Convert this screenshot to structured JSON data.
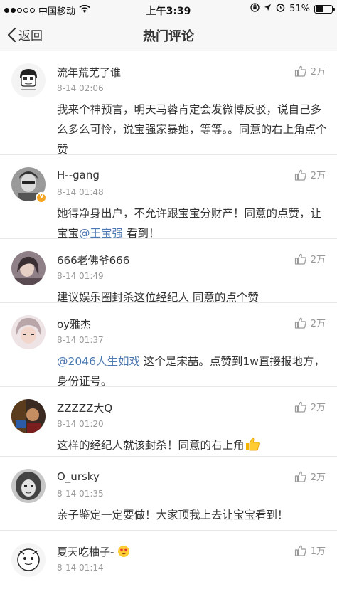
{
  "status_bar": {
    "carrier": "中国移动",
    "time": "上午3:39",
    "battery": "51%",
    "battery_level": 0.51
  },
  "nav": {
    "back_label": "返回",
    "title": "热门评论"
  },
  "comments": [
    {
      "username": "流年荒芜了谁",
      "time": "8-14 02:06",
      "likes": "2万",
      "text": "我来个神预言，明天马蓉肯定会发微博反驳，说自己多么多么可怜，说宝强家暴她，等等。。同意的右上角点个赞"
    },
    {
      "username": "H--gang",
      "time": "8-14 01:48",
      "likes": "2万",
      "verified": true,
      "text_before": "她得净身出户，不允许跟宝宝分财产！同意的点赞，让宝宝",
      "mention": "@王宝强",
      "text_after": " 看到！"
    },
    {
      "username": "666老佛爷666",
      "time": "8-14 01:49",
      "likes": "2万",
      "text": "建议娱乐圈封杀这位经纪人 同意的点个赞"
    },
    {
      "username": "oy雅杰",
      "time": "8-14 01:37",
      "likes": "2万",
      "mention": "@2046人生如戏",
      "text_after": " 这个是宋喆。点赞到1w直接报地方，身份证号。"
    },
    {
      "username": "ZZZZZ大Q",
      "time": "8-14 01:20",
      "likes": "2万",
      "text": "这样的经纪人就该封杀！同意的右上角",
      "emoji": "thumbs-up-emoji"
    },
    {
      "username": "O_ursky",
      "time": "8-14 01:35",
      "likes": "2万",
      "text": "亲子鉴定一定要做！大家顶我上去让宝宝看到！"
    },
    {
      "username": "夏天吃柚子-",
      "time": "8-14 01:14",
      "likes": "1万",
      "emoji": "heart-eyes-emoji"
    }
  ],
  "icons": {
    "back": "chevron-left-icon",
    "like": "thumbs-up-icon"
  },
  "colors": {
    "mention": "#4a78b0",
    "secondary": "#999999",
    "verified": "#f5a623"
  }
}
